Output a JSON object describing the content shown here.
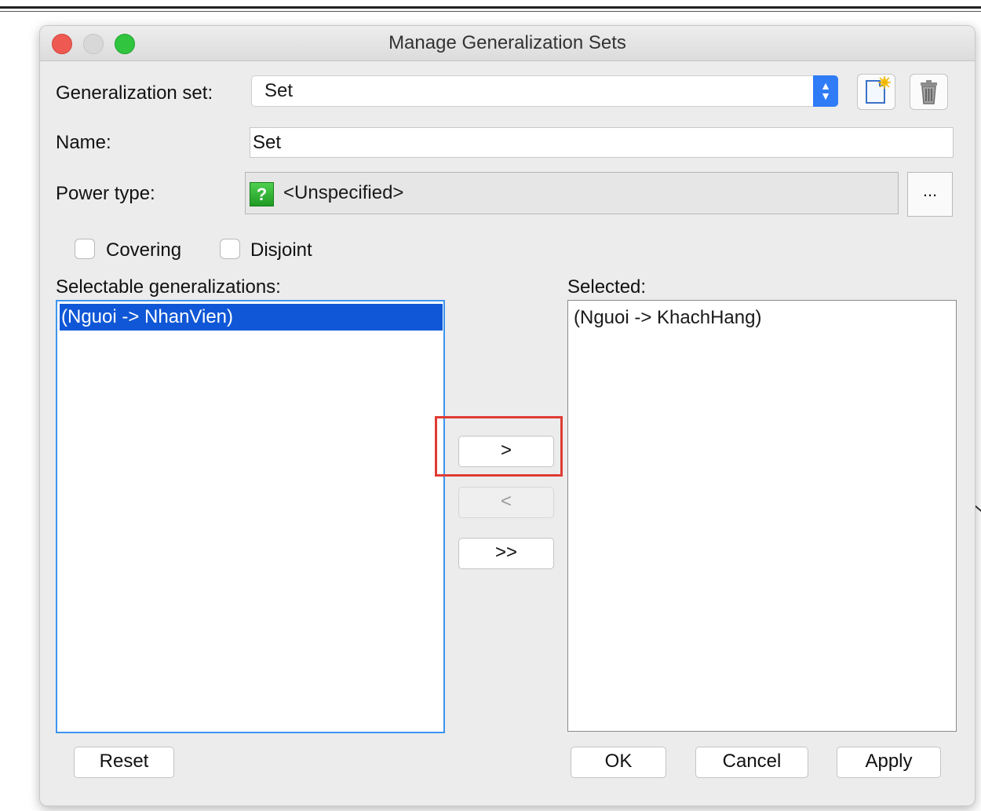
{
  "window": {
    "title": "Manage Generalization Sets"
  },
  "form": {
    "generalization_set_label": "Generalization set:",
    "generalization_set_value": "Set",
    "name_label": "Name:",
    "name_value": "Set",
    "power_type_label": "Power type:",
    "power_type_value": "<Unspecified>",
    "power_type_icon_glyph": "?",
    "browse_label": "...",
    "covering_label": "Covering",
    "disjoint_label": "Disjoint",
    "covering_checked": false,
    "disjoint_checked": false
  },
  "lists": {
    "selectable_label": "Selectable generalizations:",
    "selectable_items": [
      "(Nguoi -> NhanVien)"
    ],
    "selected_label": "Selected:",
    "selected_items": [
      "(Nguoi -> KhachHang)"
    ]
  },
  "transfer": {
    "add_label": ">",
    "remove_label": "<",
    "add_all_label": ">>"
  },
  "footer": {
    "reset_label": "Reset",
    "ok_label": "OK",
    "cancel_label": "Cancel",
    "apply_label": "Apply"
  },
  "colors": {
    "accent": "#2f7cf6",
    "selection": "#0f57d6",
    "highlight": "#e03b34"
  },
  "icons": {
    "new_set": "new-document-icon",
    "delete_set": "trash-icon",
    "power_type": "question-icon"
  }
}
